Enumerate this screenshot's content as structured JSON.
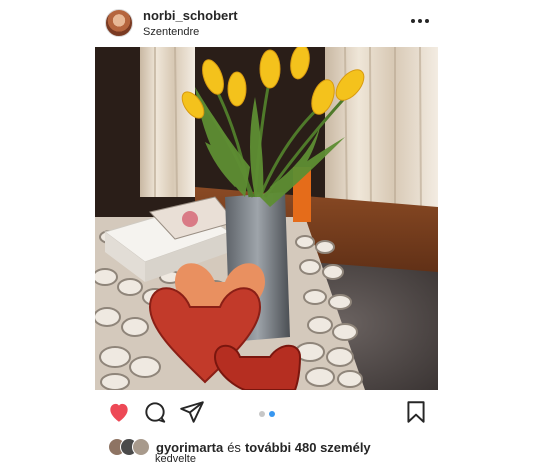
{
  "post": {
    "username": "norbi_schobert",
    "location": "Szentendre"
  },
  "icons": {
    "more": "more-options-icon",
    "like": "heart-icon",
    "comment": "comment-icon",
    "share": "direct-share-icon",
    "save": "bookmark-icon"
  },
  "carousel": {
    "count": 2,
    "active_index": 1
  },
  "likes": {
    "first_user": "gyorimarta",
    "connector": "és",
    "others": "további 480 személy",
    "suffix": "kedvelte"
  },
  "colors": {
    "like_red": "#ed4956",
    "carousel_active": "#3897f0",
    "text": "#262626"
  }
}
